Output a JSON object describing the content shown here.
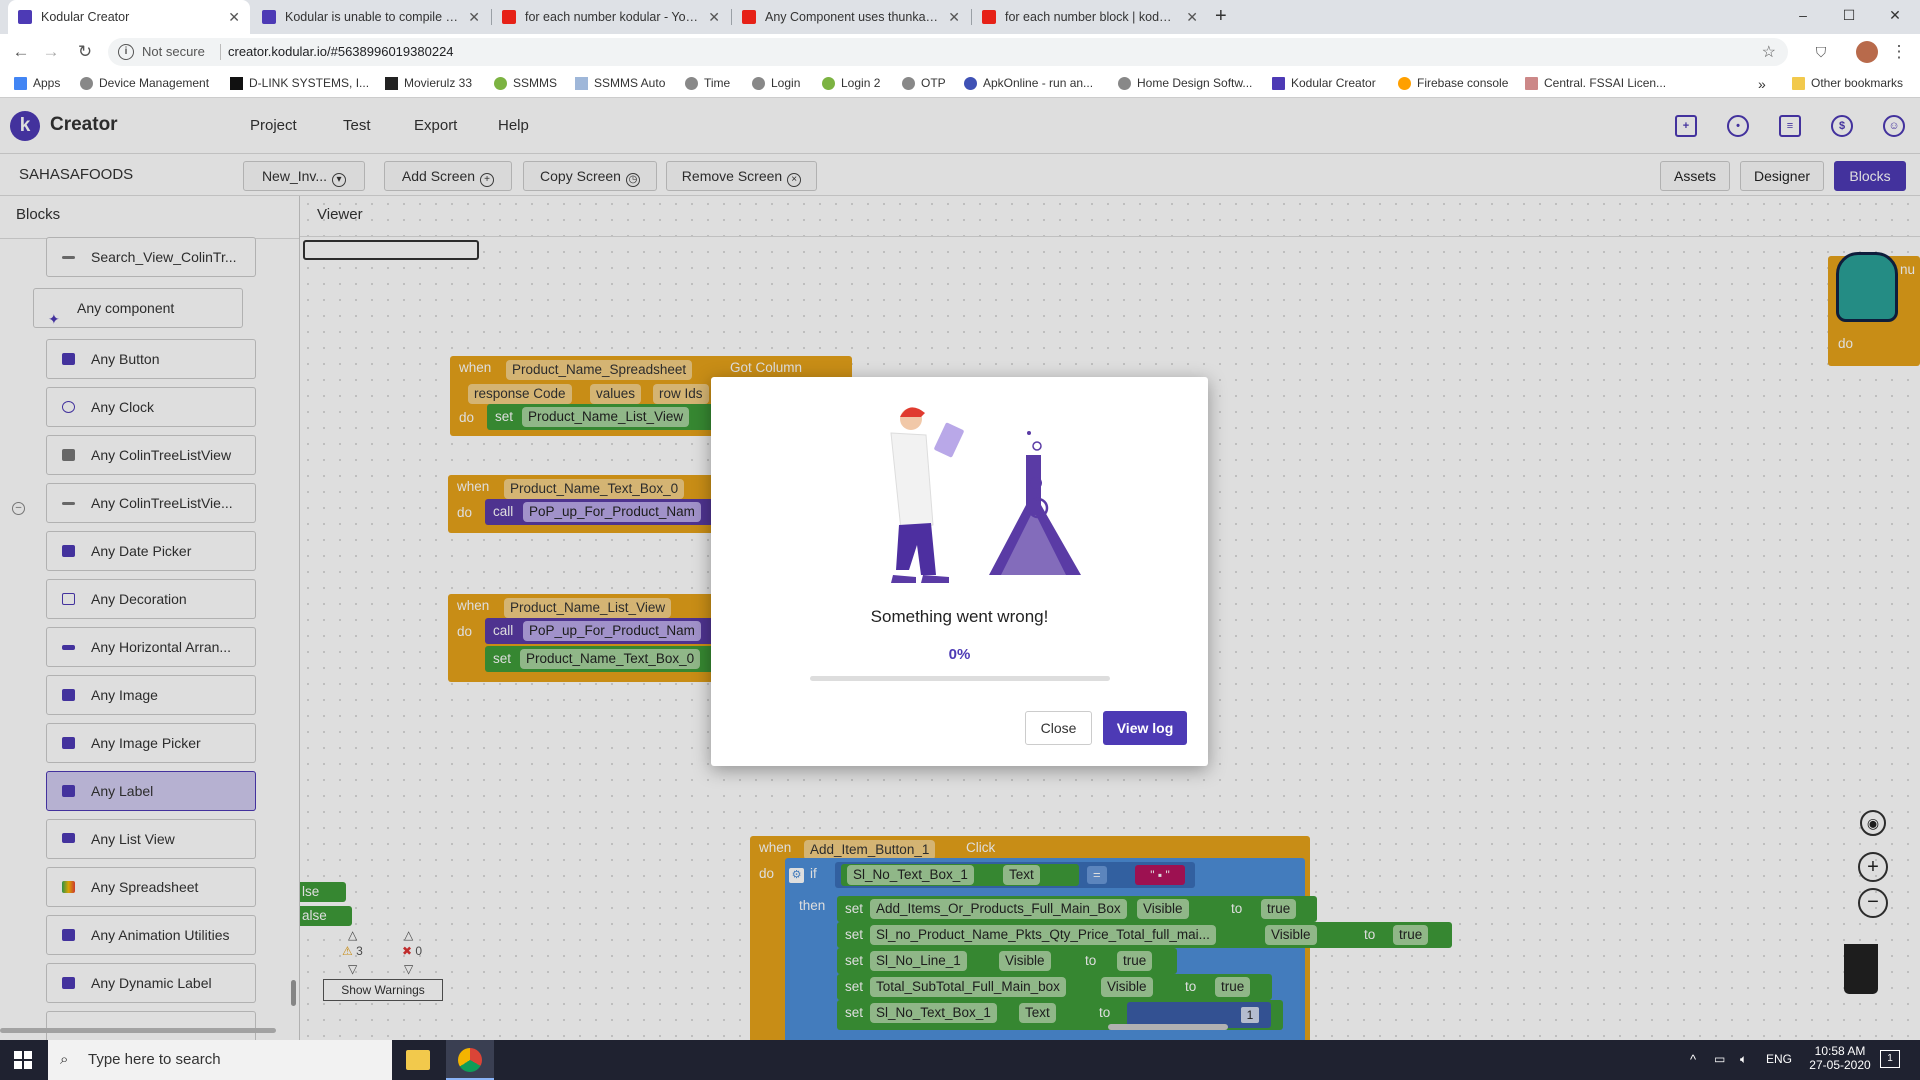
{
  "browser": {
    "tabs": [
      {
        "title": "Kodular Creator",
        "active": true,
        "favicon": "kodular-icon"
      },
      {
        "title": "Kodular is unable to compile this",
        "active": false,
        "favicon": "kodular-icon"
      },
      {
        "title": "for each number kodular - YouTu",
        "active": false,
        "favicon": "youtube-icon"
      },
      {
        "title": "Any Component uses thunkable,",
        "active": false,
        "favicon": "youtube-icon"
      },
      {
        "title": "for each number block | kodular",
        "active": false,
        "favicon": "youtube-icon"
      }
    ],
    "new_tab": "+",
    "window_controls": [
      "–",
      "☐",
      "✕"
    ],
    "security": "Not secure",
    "url": "creator.kodular.io/#5638996019380224",
    "bookmarks": [
      "Apps",
      "Device Management",
      "D-LINK SYSTEMS, I...",
      "Movierulz 33",
      "SSMMS",
      "SSMMS Auto",
      "Time",
      "Login",
      "Login 2",
      "OTP",
      "ApkOnline - run an...",
      "Home Design Softw...",
      "Kodular Creator",
      "Firebase console",
      "Central. FSSAI Licen..."
    ],
    "bookmarks_more": "»",
    "other_bookmarks": "Other bookmarks"
  },
  "app": {
    "name": "Creator",
    "menu": [
      "Project",
      "Test",
      "Export",
      "Help"
    ],
    "project_name": "SAHASAFOODS",
    "screen_dropdown": "New_Inv...",
    "screen_buttons": [
      {
        "label": "Add Screen",
        "glyph": "+"
      },
      {
        "label": "Copy Screen",
        "glyph": "◷"
      },
      {
        "label": "Remove Screen",
        "glyph": "×"
      }
    ],
    "modes": [
      "Assets",
      "Designer",
      "Blocks"
    ],
    "active_mode": "Blocks",
    "accent_color": "#4d3ab5"
  },
  "blocks_panel": {
    "title": "Blocks",
    "top_item": "Search_View_ColinTr...",
    "any_component": "Any component",
    "items": [
      "Any Button",
      "Any Clock",
      "Any ColinTreeListView",
      "Any ColinTreeListVie...",
      "Any Date Picker",
      "Any Decoration",
      "Any Horizontal Arran...",
      "Any Image",
      "Any Image Picker",
      "Any Label",
      "Any List View",
      "Any Spreadsheet",
      "Any Animation Utilities",
      "Any Dynamic Label"
    ],
    "selected_item": "Any Label"
  },
  "viewer": {
    "title": "Viewer",
    "block1": {
      "when": "when",
      "component": "Product_Name_Spreadsheet",
      "event": "Got Column",
      "params": [
        "response Code",
        "values",
        "row Ids"
      ],
      "do": "do",
      "set": "set",
      "target": "Product_Name_List_View"
    },
    "block2": {
      "when": "when",
      "component": "Product_Name_Text_Box_0",
      "do": "do",
      "call": "call",
      "proc": "PoP_up_For_Product_Nam"
    },
    "block3": {
      "when": "when",
      "component": "Product_Name_List_View",
      "do": "do",
      "call": "call",
      "proc": "PoP_up_For_Product_Nam",
      "set": "set",
      "target": "Product_Name_Text_Box_0"
    },
    "block4": {
      "when": "when",
      "component": "Add_Item_Button_1",
      "event": "Click",
      "do": "do",
      "if": "if",
      "then": "then",
      "cond_comp": "Sl_No_Text_Box_1",
      "cond_prop": "Text",
      "cond_op": "=",
      "rows": [
        {
          "set": "set",
          "comp": "Add_Items_Or_Products_Full_Main_Box",
          "prop": "Visible",
          "to": "to",
          "val": "true"
        },
        {
          "set": "set",
          "comp": "Sl_no_Product_Name_Pkts_Qty_Price_Total_full_mai...",
          "prop": "Visible",
          "to": "to",
          "val": "true"
        },
        {
          "set": "set",
          "comp": "Sl_No_Line_1",
          "prop": "Visible",
          "to": "to",
          "val": "true"
        },
        {
          "set": "set",
          "comp": "Total_SubTotal_Full_Main_box",
          "prop": "Visible",
          "to": "to",
          "val": "true"
        },
        {
          "set": "set",
          "comp": "Sl_No_Text_Box_1",
          "prop": "Text",
          "to": "to",
          "val": "1"
        }
      ]
    },
    "partial_left": [
      "lse",
      "alse"
    ],
    "right_block": {
      "label": "nu",
      "do": "do"
    },
    "warnings_count": "3",
    "errors_count": "0",
    "show_warnings": "Show Warnings"
  },
  "dialog": {
    "message": "Something went wrong!",
    "progress_text": "0%",
    "progress": 0,
    "close_label": "Close",
    "view_log_label": "View log"
  },
  "taskbar": {
    "search_placeholder": "Type here to search",
    "language": "ENG",
    "time": "10:58 AM",
    "date": "27-05-2020",
    "notifications": "1"
  }
}
